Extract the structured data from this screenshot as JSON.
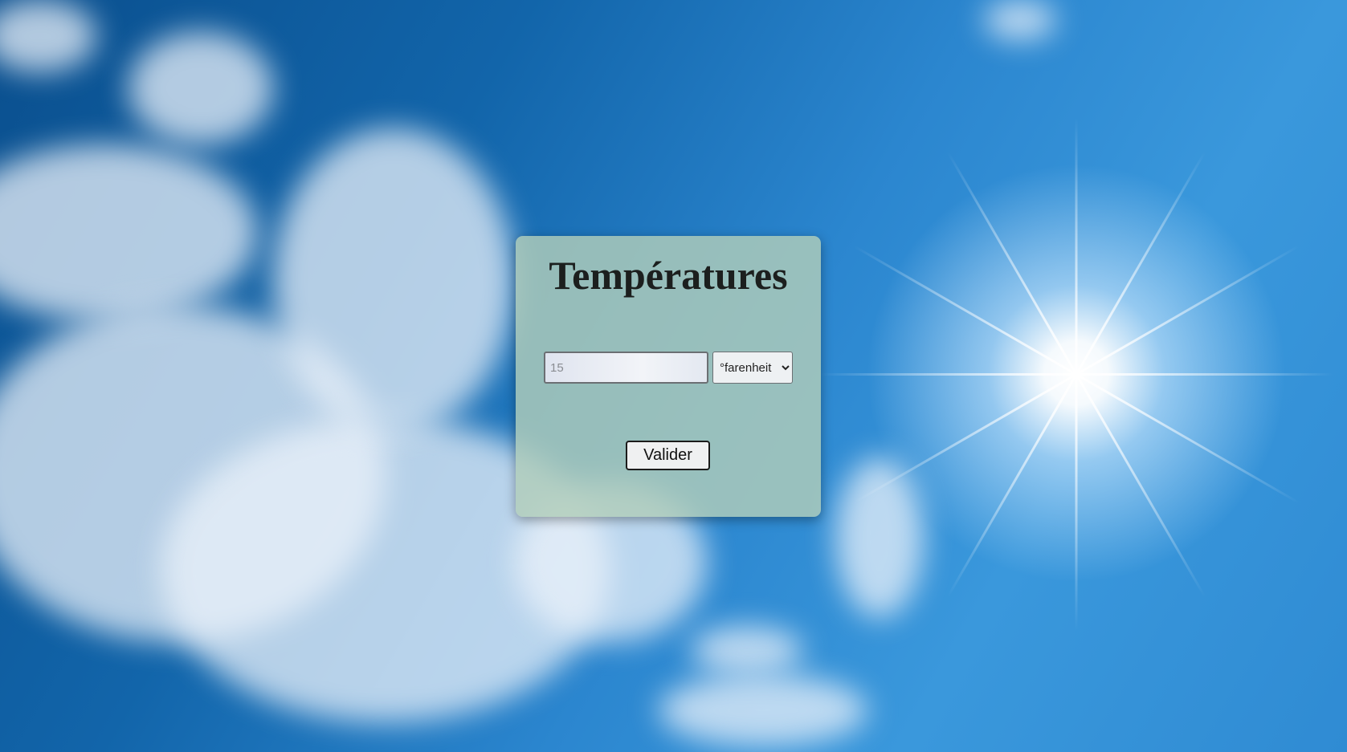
{
  "page": {
    "background": "sunny-blue-sky-with-clouds"
  },
  "form": {
    "title": "Températures",
    "temperature_input": {
      "value": "",
      "placeholder": "15"
    },
    "unit_select": {
      "selected": "°farenheit",
      "options": [
        "°farenheit"
      ]
    },
    "submit_label": "Valider"
  },
  "colors": {
    "panel": "#b1cdb9",
    "sky": "#2b86cf"
  }
}
